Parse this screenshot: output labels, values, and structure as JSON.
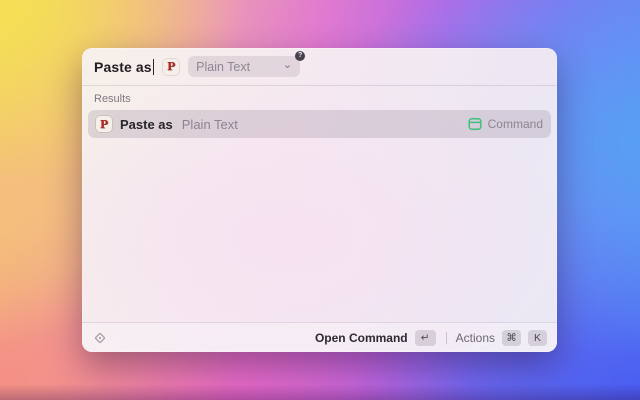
{
  "window": {
    "search": {
      "value": "Paste as",
      "extension_icon_letter": "P",
      "dropdown_value": "Plain Text",
      "help_badge": "?"
    },
    "results": {
      "header": "Results",
      "items": [
        {
          "icon_letter": "P",
          "title": "Paste as",
          "subtitle": "Plain Text",
          "type": "Command"
        }
      ]
    },
    "footer": {
      "primary_action": "Open Command",
      "primary_key": "↵",
      "actions_label": "Actions",
      "actions_keys": [
        "⌘",
        "K"
      ]
    }
  },
  "icons": {
    "chevron_down": "⌄"
  },
  "colors": {
    "command_icon_green": "#3fbf7c",
    "extension_icon_red": "#b3261e",
    "selection_background": "#d7cdd8"
  }
}
